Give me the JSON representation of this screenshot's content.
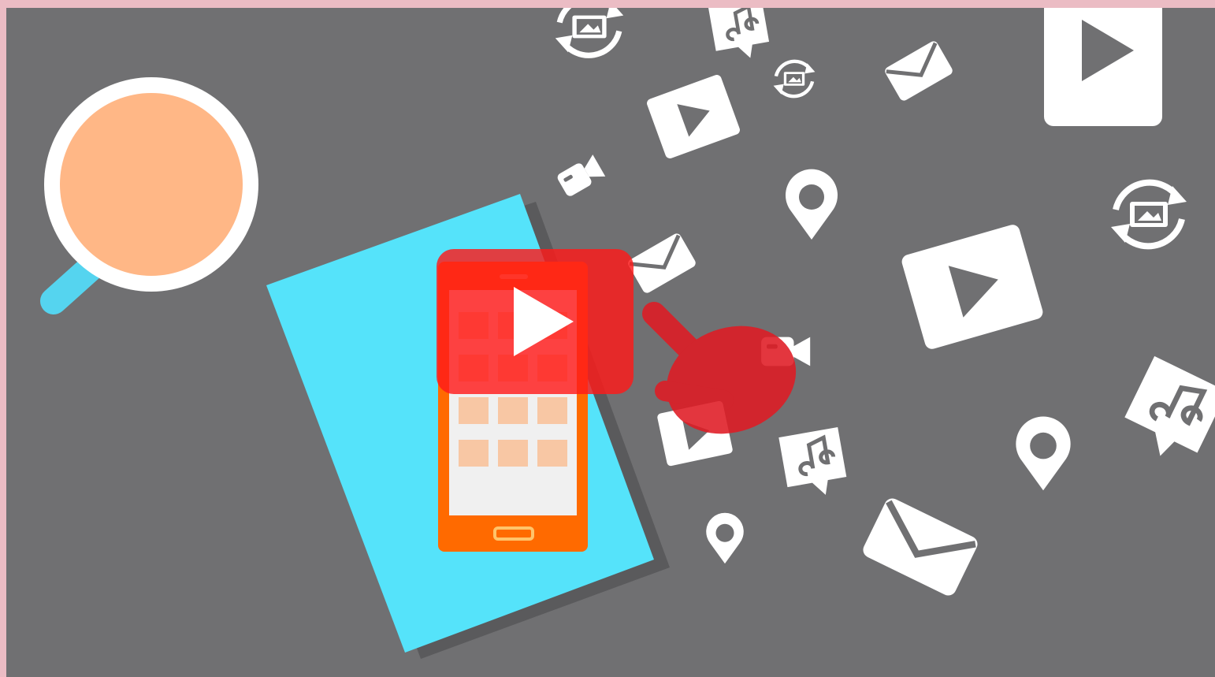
{
  "video": {
    "play_label": "Play video",
    "state": "paused"
  },
  "colors": {
    "page_border": "#ebbcc4",
    "background": "#707072",
    "tablet": "#55e3fa",
    "phone": "#ff6a00",
    "phone_screen": "#f0f0f0",
    "app_tile": "#f8c7a4",
    "mug_coffee": "#ffb786",
    "mug_rim": "#ffffff",
    "mug_handle": "#55d4ef",
    "play_overlay": "#ff1a1a",
    "hand_pointer": "#e01b24",
    "icons": "#ffffff"
  },
  "icons": [
    "coffee-mug-icon",
    "tablet-icon",
    "smartphone-icon",
    "play-icon",
    "envelope-icon",
    "music-note-icon",
    "map-pin-icon",
    "video-camera-icon",
    "sync-image-icon",
    "hand-pointer-icon"
  ]
}
